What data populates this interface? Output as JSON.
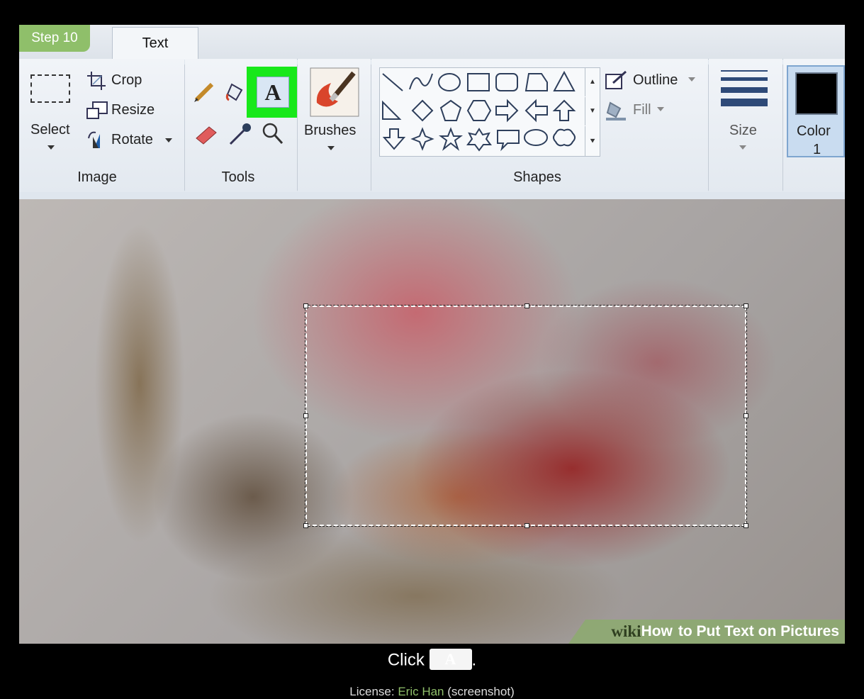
{
  "step_badge": "Step 10",
  "tabs": {
    "text_tab": "Text"
  },
  "image_group": {
    "label": "Image",
    "select_label": "Select",
    "crop_label": "Crop",
    "resize_label": "Resize",
    "rotate_label": "Rotate"
  },
  "tools_group": {
    "label": "Tools",
    "text_tool_glyph": "A",
    "highlight_color": "#18e81a"
  },
  "brushes": {
    "label": "Brushes"
  },
  "shapes_group": {
    "label": "Shapes",
    "outline_label": "Outline",
    "fill_label": "Fill"
  },
  "size": {
    "label": "Size"
  },
  "color": {
    "label": "Color",
    "number": "1",
    "current": "#000000"
  },
  "watermark": {
    "wiki": "wiki",
    "how": "How",
    "title": "to Put Text on Pictures"
  },
  "caption": {
    "prefix": "Click",
    "button_glyph": "A",
    "suffix": "."
  },
  "license": {
    "prefix": "License:",
    "author": "Eric Han",
    "suffix": "(screenshot)"
  }
}
